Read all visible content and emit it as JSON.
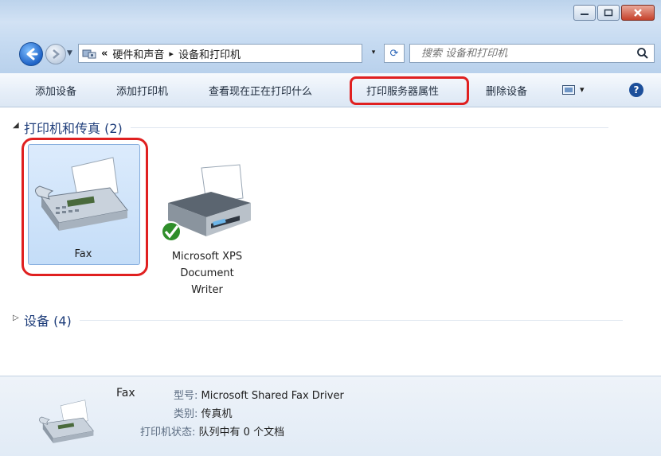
{
  "addressbar": {
    "overflow_glyph": "«",
    "crumb_1": "硬件和声音",
    "separator": "▸",
    "crumb_2": "设备和打印机",
    "dropdown_glyph": "▾",
    "refresh_glyph": "⟳"
  },
  "search": {
    "placeholder": "搜索 设备和打印机"
  },
  "toolbar": {
    "add_device": "添加设备",
    "add_printer": "添加打印机",
    "see_printing": "查看现在正在打印什么",
    "print_server_props": "打印服务器属性",
    "remove_device": "删除设备",
    "view_dropdown": "▾",
    "help": "?"
  },
  "groups": {
    "printers_header": "打印机和传真 (2)",
    "devices_header": "设备 (4)"
  },
  "devices": [
    {
      "name": "Fax",
      "selected": true
    },
    {
      "name_line1": "Microsoft XPS",
      "name_line2": "Document",
      "name_line3": "Writer",
      "selected": false
    }
  ],
  "details": {
    "name": "Fax",
    "model_label": "型号:",
    "model_value": "Microsoft Shared Fax Driver",
    "category_label": "类别:",
    "category_value": "传真机",
    "status_label": "打印机状态:",
    "status_value": "队列中有 0 个文档"
  },
  "colors": {
    "highlight_ring": "#e02020",
    "selection": "#cfe3fa",
    "group_header": "#1e3d7a"
  },
  "icons": [
    "back-icon",
    "forward-icon",
    "devices-icon",
    "refresh-icon",
    "search-icon",
    "view-icon",
    "help-icon",
    "fax-icon",
    "printer-icon",
    "check-badge-icon"
  ]
}
